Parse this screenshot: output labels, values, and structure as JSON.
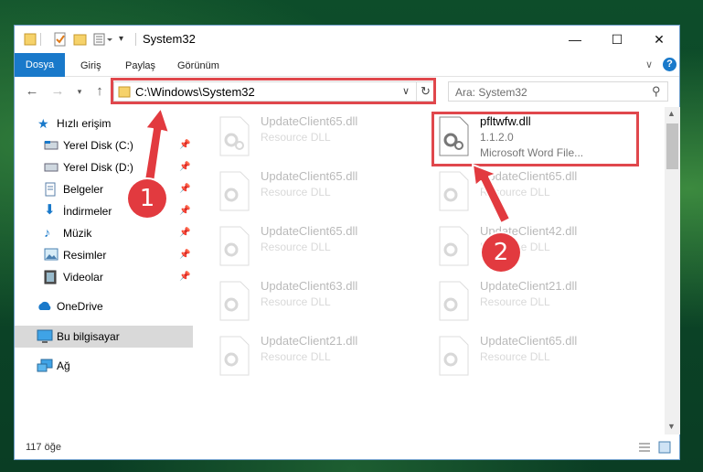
{
  "window": {
    "title": "System32"
  },
  "controls": {
    "minimize": "—",
    "maximize": "☐",
    "close": "✕"
  },
  "ribbon": {
    "tabs": [
      "Dosya",
      "Giriş",
      "Paylaş",
      "Görünüm"
    ],
    "help": "?"
  },
  "address": {
    "path": "C:\\Windows\\System32"
  },
  "search": {
    "placeholder": "Ara: System32"
  },
  "sidebar": {
    "items": [
      {
        "label": "Hızlı erişim"
      },
      {
        "label": "Yerel Disk (C:)"
      },
      {
        "label": "Yerel Disk (D:)"
      },
      {
        "label": "Belgeler"
      },
      {
        "label": "İndirmeler"
      },
      {
        "label": "Müzik"
      },
      {
        "label": "Resimler"
      },
      {
        "label": "Videolar"
      },
      {
        "label": "OneDrive"
      },
      {
        "label": "Bu bilgisayar"
      },
      {
        "label": "Ağ"
      }
    ]
  },
  "files": [
    {
      "name": "UpdateClient65.dll",
      "type": "Resource DLL"
    },
    {
      "name": "pfltwfw.dll",
      "version": "1.1.2.0",
      "type": "Microsoft Word File..."
    },
    {
      "name": "UpdateClient65.dll",
      "type": "Resource DLL"
    },
    {
      "name": "UpdateClient65.dll",
      "type": "Resource DLL"
    },
    {
      "name": "UpdateClient65.dll",
      "type": "Resource DLL"
    },
    {
      "name": "UpdateClient42.dll",
      "type": "Resource DLL"
    },
    {
      "name": "UpdateClient63.dll",
      "type": "Resource DLL"
    },
    {
      "name": "UpdateClient21.dll",
      "type": "Resource DLL"
    },
    {
      "name": "UpdateClient21.dll",
      "type": "Resource DLL"
    },
    {
      "name": "UpdateClient65.dll",
      "type": "Resource DLL"
    }
  ],
  "status": {
    "count": "117 öğe"
  },
  "annotations": {
    "step1": "1",
    "step2": "2"
  },
  "colors": {
    "accent": "#1979ca",
    "highlight": "#e0474c",
    "badge": "#e23a3f"
  }
}
